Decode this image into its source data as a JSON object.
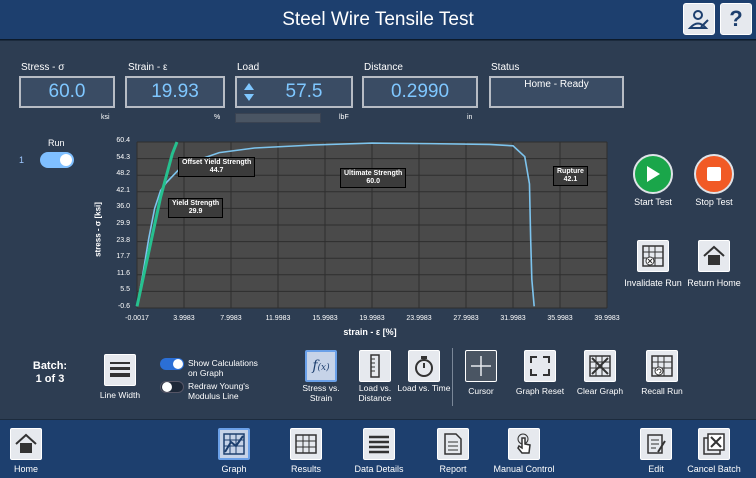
{
  "header": {
    "title": "Steel Wire Tensile Test"
  },
  "readouts": [
    {
      "label": "Stress - σ",
      "value": "60.0",
      "unit": "ksi"
    },
    {
      "label": "Strain - ε",
      "value": "19.93",
      "unit": "%"
    },
    {
      "label": "Load",
      "value": "57.5",
      "unit": "lbF"
    },
    {
      "label": "Distance",
      "value": "0.2990",
      "unit": "in"
    },
    {
      "label": "Status",
      "value": "Home - Ready",
      "unit": ""
    }
  ],
  "run": {
    "label": "Run",
    "index": "1",
    "enabled": true
  },
  "chart_data": {
    "type": "line",
    "xlabel": "strain - ε [%]",
    "ylabel": "stress - σ [ksi]",
    "xlim": [
      -0.0017,
      39.9983
    ],
    "ylim": [
      -0.6,
      60.4
    ],
    "xticks": [
      "-0.0017",
      "3.9983",
      "7.9983",
      "11.9983",
      "15.9983",
      "19.9983",
      "23.9983",
      "27.9983",
      "31.9983",
      "35.9983",
      "39.9983"
    ],
    "yticks": [
      "60.4",
      "54.3",
      "48.2",
      "42.1",
      "36.0",
      "29.9",
      "23.8",
      "17.7",
      "11.6",
      "5.5",
      "-0.6"
    ],
    "grid": true,
    "series": [
      {
        "name": "",
        "color": "#7dc4ee",
        "x": [
          0.0,
          0.5,
          1.0,
          1.5,
          2.0,
          2.5,
          3.5,
          5,
          7,
          10,
          15,
          20,
          25,
          30,
          32,
          33,
          33.4,
          33.5,
          33.6,
          33.8
        ],
        "y": [
          0.0,
          12,
          25,
          36,
          42.5,
          45.5,
          50,
          53.5,
          56.5,
          58.2,
          59.3,
          60.0,
          59.8,
          59.5,
          59.0,
          55,
          45,
          25,
          10,
          0.0
        ]
      },
      {
        "name": "",
        "color": "#26c08f",
        "x": [
          0.0,
          0.5,
          1.0,
          1.5,
          2.0,
          2.5,
          3.0,
          3.4
        ],
        "y": [
          0.0,
          10,
          20,
          30,
          40,
          48,
          56,
          60.4
        ]
      }
    ],
    "annotations": [
      {
        "text": "Offset Yield Strength",
        "value": "44.7"
      },
      {
        "text": "Yield Strength",
        "value": "29.9"
      },
      {
        "text": "Ultimate Strength",
        "value": "60.0"
      },
      {
        "text": "Rupture",
        "value": "42.1"
      }
    ]
  },
  "controls": {
    "start": "Start Test",
    "stop": "Stop Test",
    "invalidate": "Invalidate Run",
    "return_home": "Return Home",
    "start_color": "#1aa64a",
    "stop_color": "#f15a25"
  },
  "batch": {
    "label": "Batch:",
    "value": "1 of 3"
  },
  "toolbar": {
    "line_width": "Line Width",
    "show_calc": "Show Calculations on Graph",
    "redraw": "Redraw Young's Modulus Line",
    "stress_strain": "Stress vs. Strain",
    "load_distance": "Load vs. Distance",
    "load_time": "Load vs. Time",
    "cursor": "Cursor",
    "graph_reset": "Graph Reset",
    "clear_graph": "Clear Graph",
    "recall_run": "Recall Run"
  },
  "nav": [
    "Home",
    "Graph",
    "Results",
    "Data Details",
    "Report",
    "Manual Control",
    "Edit",
    "Cancel Batch"
  ]
}
